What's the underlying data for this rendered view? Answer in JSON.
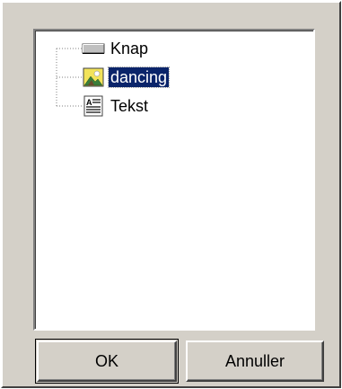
{
  "tree": {
    "items": [
      {
        "label": "Knap",
        "icon": "button-icon",
        "selected": false
      },
      {
        "label": "dancing",
        "icon": "picture-icon",
        "selected": true
      },
      {
        "label": "Tekst",
        "icon": "text-icon",
        "selected": false
      }
    ]
  },
  "buttons": {
    "ok_label": "OK",
    "cancel_label": "Annuller"
  },
  "colors": {
    "dialog_bg": "#d4d0c8",
    "panel_bg": "#ffffff",
    "selection": "#0a246a",
    "picture_icon_fill": "#f2e35a"
  }
}
